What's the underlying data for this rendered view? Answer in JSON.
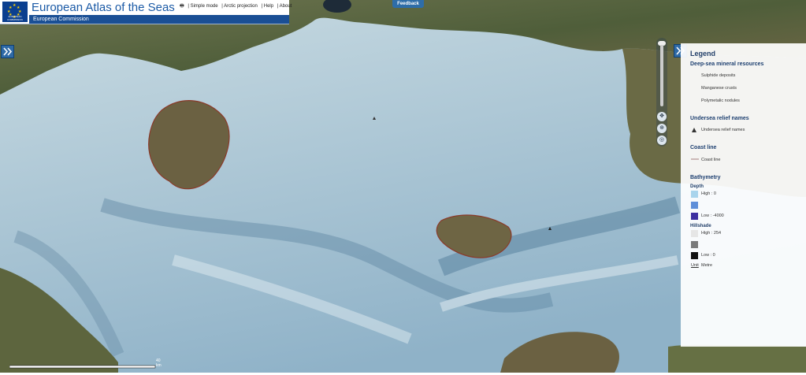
{
  "header": {
    "title": "European Atlas of the Seas",
    "subtitle": "European Commission",
    "logo_caption": "EUROPEAN COMMISSION",
    "links": [
      "Simple mode",
      "Arctic projection",
      "Help",
      "About"
    ],
    "feedback": "Feedback"
  },
  "legend": {
    "title": "Legend",
    "minerals": {
      "title": "Deep-sea mineral resources",
      "items": [
        "Sulphide deposits",
        "Manganese crusts",
        "Polymetalic nodules"
      ]
    },
    "relief": {
      "title": "Undersea relief names",
      "item": "Undersea relief names"
    },
    "coast": {
      "title": "Coast line",
      "item": "Coast line"
    },
    "bathymetry": {
      "title": "Bathymetry",
      "depth": {
        "title": "Depth",
        "high": "High : 0",
        "low": "Low : -4000"
      },
      "hillshade": {
        "title": "Hillshade",
        "high": "High : 254",
        "low": "Low : 0"
      },
      "unit_label": "Unit",
      "unit_value": "Metre"
    }
  },
  "map": {
    "scale_label": "40 km"
  },
  "colors": {
    "sea": "#b6ccd6",
    "land": "#6b6b48",
    "header_blue": "#1a4f95",
    "legend_title": "#23406a"
  }
}
